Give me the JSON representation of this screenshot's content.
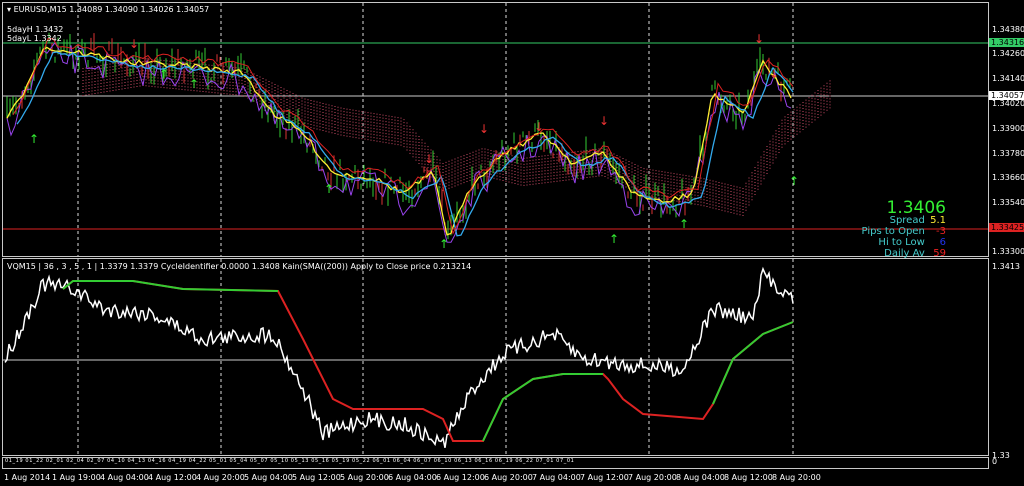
{
  "main": {
    "header": "EURUSD,M15  1.34089 1.34090 1.34026 1.34057",
    "five_day_high": "5dayH 1.3432",
    "five_day_low": "5dayL 1.3342",
    "price_axis": [
      "1.34380",
      "1.34260",
      "1.34140",
      "1.34020",
      "1.33900",
      "1.33780",
      "1.33660",
      "1.33540",
      "1.33300"
    ],
    "high_tag": "1.34316",
    "current_tag": "1.34057",
    "low_tag": "1.33425",
    "colors": {
      "high": "#33cc66",
      "low": "#dd2222",
      "current": "#ffffff"
    },
    "info": {
      "price": "1.3406",
      "spread_label": "Spread",
      "spread_value": "5.1",
      "pips_label": "Pips to Open",
      "pips_value": "-3",
      "hilo_label": "Hi to Low",
      "hilo_value": "6",
      "daily_label": "Daily Av",
      "daily_value": "59"
    }
  },
  "indicator": {
    "header": "VQM15 | 36 , 3 , 5 , 1  |  1.3379 1.3379  CycleIdentifier 0.0000 1.3408  Kain(SMA((200)) Apply to Close price 0.213214",
    "axis_top": "1.3413",
    "axis_bottom": "1.33"
  },
  "strip": {
    "labels": "01_19 01_22 02_01 02_04 02_07 04_10 04_13 04_16 04_19 04_22 05_01 05_04 05_07 05_10 05_13 05_16 05_19 05_22 06_01 06_04 06_07 06_10 06_13 06_16 06_19 06_22 07_01 07_01",
    "axis": "0"
  },
  "time_axis": [
    "1 Aug 2014",
    "1 Aug 19:00",
    "4 Aug 04:00",
    "4 Aug 12:00",
    "4 Aug 20:00",
    "5 Aug 04:00",
    "5 Aug 12:00",
    "5 Aug 20:00",
    "6 Aug 04:00",
    "6 Aug 12:00",
    "6 Aug 20:00",
    "7 Aug 04:00",
    "7 Aug 12:00",
    "7 Aug 20:00",
    "8 Aug 04:00",
    "8 Aug 12:00",
    "8 Aug 20:00"
  ]
}
